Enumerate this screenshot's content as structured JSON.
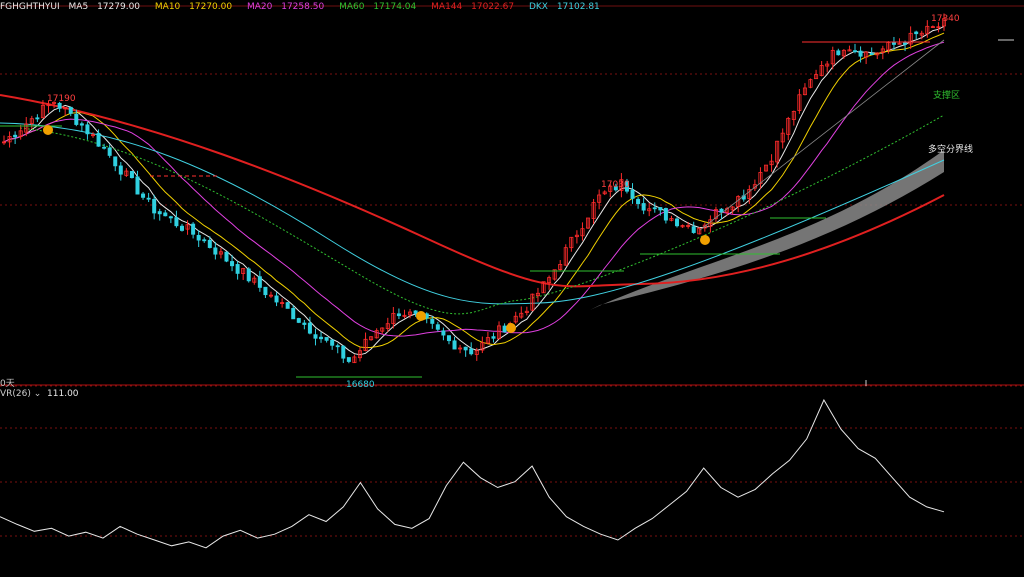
{
  "header": {
    "symbol": "FGHGHTHYUI",
    "ma": [
      {
        "label": "MA5",
        "value": "17279.00",
        "color": "#e8e8e8"
      },
      {
        "label": "MA10",
        "value": "17270.00",
        "color": "#f0d000"
      },
      {
        "label": "MA20",
        "value": "17258.50",
        "color": "#e040e0"
      },
      {
        "label": "MA60",
        "value": "17174.04",
        "color": "#30c030"
      },
      {
        "label": "MA144",
        "value": "17022.67",
        "color": "#e02020"
      },
      {
        "label": "DKX",
        "value": "17102.81",
        "color": "#40d0e0"
      }
    ]
  },
  "annotations": {
    "high_left": "17190",
    "mid_peak": "17030",
    "high_right": "17340",
    "low": "16680",
    "support_zone": "支撑区",
    "bull_bear_line": "多空分界线",
    "day_label": "0天"
  },
  "indicator": {
    "name": "VR(26)",
    "value": "111.00"
  },
  "colors": {
    "up_candle": "#ff2b2b",
    "down_candle": "#30d0e0",
    "annotation_red": "#ff4040",
    "annotation_green": "#30c030",
    "cloud": "#8a8a8a",
    "signal_dot": "#f0a000"
  },
  "chart_data": {
    "type": "candlestick",
    "notes": "Approximate price path read from the main panel; y-axis unlabeled",
    "key_levels": [
      {
        "label": "17190",
        "type": "swing-high"
      },
      {
        "label": "16680",
        "type": "swing-low"
      },
      {
        "label": "17030",
        "type": "swing-high"
      },
      {
        "label": "17340",
        "type": "swing-high"
      }
    ],
    "price_path": [
      17110,
      17150,
      17190,
      17150,
      17100,
      17040,
      16980,
      16950,
      16920,
      16880,
      16840,
      16800,
      16760,
      16720,
      16680,
      16740,
      16780,
      16760,
      16720,
      16700,
      16740,
      16780,
      16840,
      16920,
      17000,
      17030,
      16980,
      16960,
      16940,
      16980,
      17010,
      17080,
      17180,
      17260,
      17300,
      17280,
      17300,
      17320,
      17340
    ],
    "ma_lines": [
      {
        "name": "MA144",
        "color": "#e02020"
      },
      {
        "name": "DKX",
        "color": "#40d0e0"
      },
      {
        "name": "MA60",
        "color": "#30c030"
      }
    ],
    "indicator_series": {
      "name": "VR(26)",
      "last": 111.0,
      "values": [
        60,
        52,
        45,
        48,
        40,
        44,
        38,
        50,
        42,
        36,
        30,
        34,
        28,
        40,
        46,
        38,
        42,
        50,
        62,
        55,
        70,
        95,
        68,
        52,
        48,
        58,
        92,
        116,
        100,
        90,
        96,
        112,
        80,
        60,
        50,
        42,
        36,
        48,
        58,
        72,
        86,
        110,
        90,
        80,
        88,
        104,
        118,
        140,
        180,
        150,
        130,
        120,
        100,
        80,
        70,
        65
      ]
    }
  }
}
